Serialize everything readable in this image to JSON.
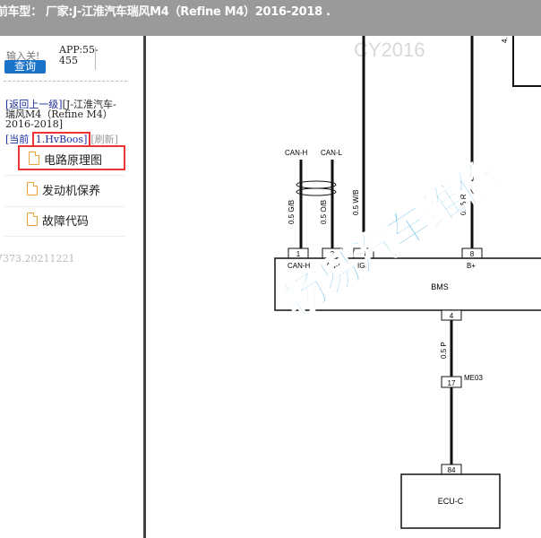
{
  "header": {
    "title": "前车型： 厂家:J-江淮汽车瑞风M4（Refine M4）2016-2018  ."
  },
  "sidebar": {
    "search_placeholder": "输入关!",
    "query_label": "查询",
    "app_version": "APP:55-455",
    "back_link": "[返回上一级]",
    "vehicle": "[J-江淮汽车-瑞风M4（Refine M4） 2016-2018]",
    "current_label": "[当前",
    "current_value": "1.HvBoos]",
    "refresh_label": "[刷新]",
    "menu": [
      {
        "label": "电路原理图",
        "icon": "document-icon"
      },
      {
        "label": "发动机保养",
        "icon": "document-icon"
      },
      {
        "label": "故障代码",
        "icon": "document-icon"
      }
    ],
    "version": "7373.20211221"
  },
  "diagram": {
    "watermark_top": "CY2016",
    "watermark_main": "畅易汽车维修",
    "wires": [
      {
        "label": "CAN-H",
        "gauge": "0.5 G/B",
        "pin": "1",
        "pin_label": "CAN-H"
      },
      {
        "label": "CAN-L",
        "gauge": "0.5 O/B",
        "pin": "2",
        "pin_label": "CAN-L"
      },
      {
        "label": "",
        "gauge": "0.5 W/B",
        "pin": "6",
        "pin_label": "IGN"
      },
      {
        "label": "",
        "gauge": "0.85 R",
        "pin": "8",
        "pin_label": "B+"
      }
    ],
    "top_right_label": "4.",
    "module": "BMS",
    "bms_out_pin": "4",
    "lower_gauge": "0.5 P",
    "connector_id": "ME03",
    "connector_pin": "17",
    "ecu_pin": "84",
    "ecu": "ECU-C"
  },
  "colors": {
    "header_bg": "#9a9a9a",
    "button_bg": "#1a73c9",
    "highlight": "#e33333",
    "link": "#1a2f9c",
    "icon": "#e8a23a"
  }
}
